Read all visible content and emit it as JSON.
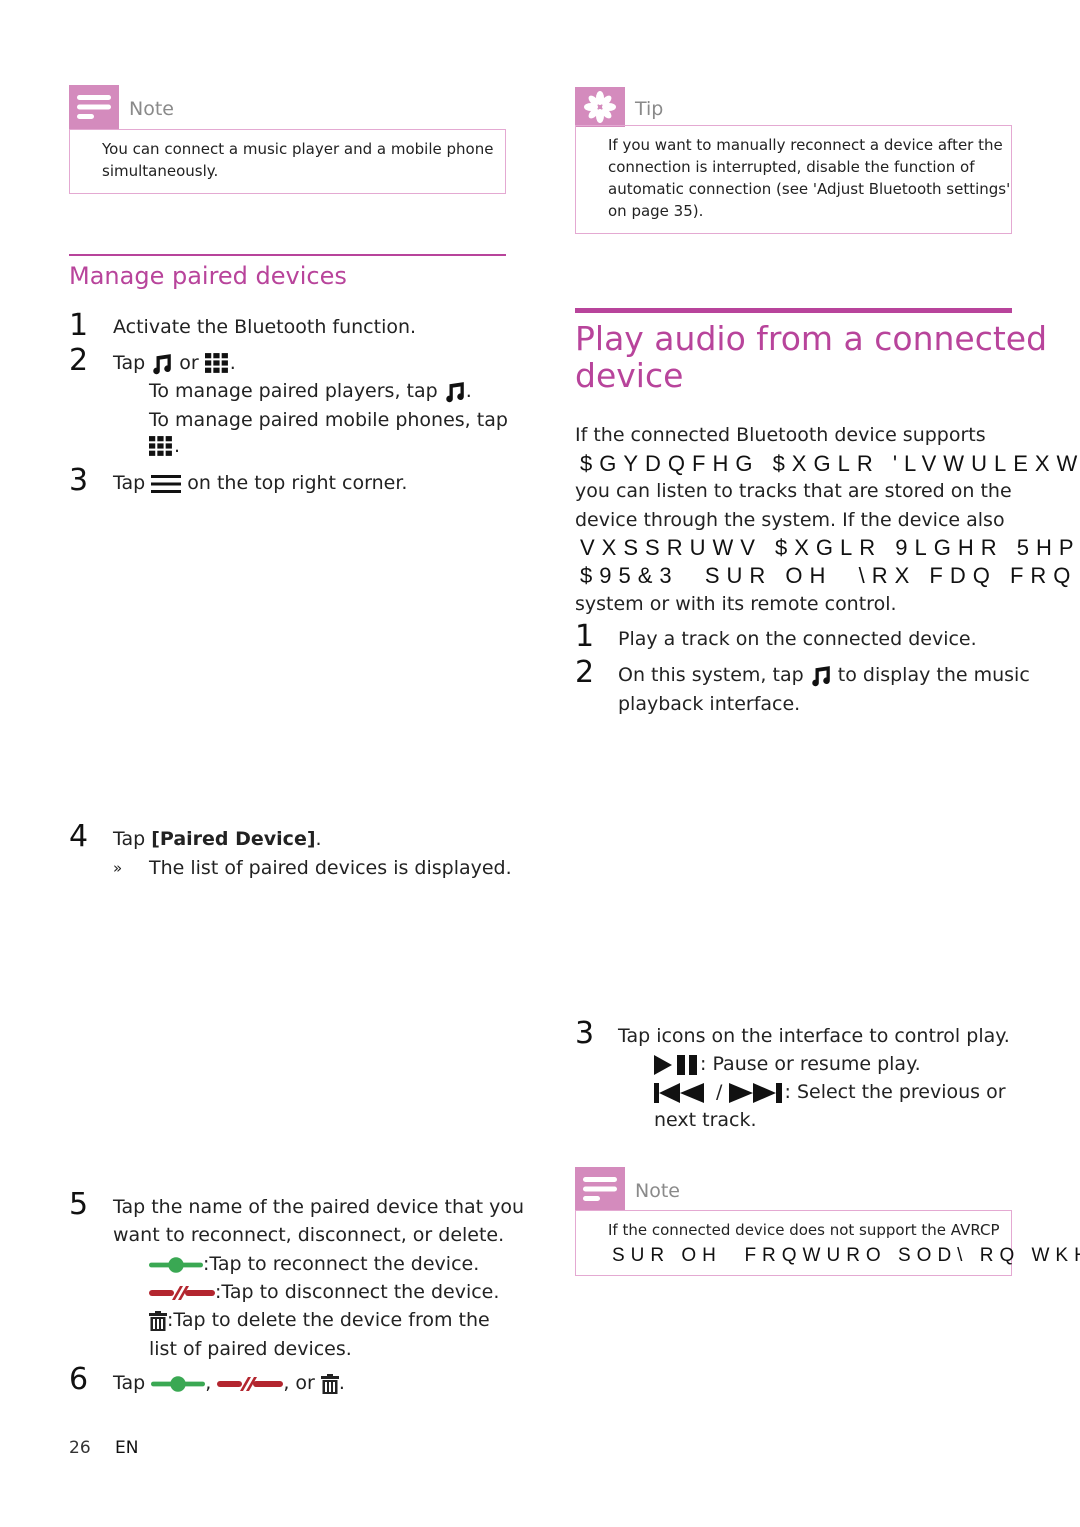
{
  "left": {
    "note": {
      "label": "Note",
      "icon": "note-lines-icon",
      "text_lines": [
        "You can connect a music player and a mobile phone",
        "simultaneously."
      ]
    },
    "section_title": "Manage paired devices",
    "steps": [
      {
        "num": "1",
        "text": "Activate the Bluetooth function."
      },
      {
        "num": "2",
        "text_a": "Tap",
        "text_b": "or",
        "text_c": ".",
        "sub1": "To manage paired players, tap",
        "sub1_end": ".",
        "sub2": "To manage paired mobile phones, tap",
        "sub2_end": "."
      },
      {
        "num": "3",
        "text_a": "Tap",
        "text_b": "on the top right corner."
      },
      {
        "num": "4",
        "text_a": "Tap",
        "bold": "[Paired Device]",
        "text_b": ".",
        "result_marker": "»",
        "result": "The list of paired devices is displayed."
      },
      {
        "num": "5",
        "line1": "Tap the name of the paired device that you",
        "line2": "want to reconnect, disconnect, or delete.",
        "reconnect": ":Tap to reconnect the device.",
        "disconnect": ":Tap to disconnect the device.",
        "delete_a": ":Tap to delete the device from the",
        "delete_b": "list of paired devices."
      },
      {
        "num": "6",
        "text_a": "Tap",
        "sep1": ",",
        "sep2": ", or",
        "end": "."
      }
    ]
  },
  "right": {
    "tip": {
      "label": "Tip",
      "icon": "asterisk-icon",
      "text_lines": [
        "If you want to manually reconnect a device after the",
        "connection is interrupted, disable the function of",
        "automatic connection (see 'Adjust Bluetooth settings'",
        "on page 35)."
      ]
    },
    "section_title_lines": [
      "Play audio from a connected",
      "device"
    ],
    "intro": {
      "line1": "If the connected Bluetooth device supports",
      "garbled1": "$GYDQFHG $XGLR 'LVWULEXW",
      "line3": "you can listen to tracks that are stored on the",
      "line4": "device through the system. If the device also",
      "garbled2": "VXSSRUWV $XGLR 9LGHR 5HP",
      "garbled3": "$95&3  SUR OH  \\RX FDQ FRQ",
      "line7": "system or with its remote control."
    },
    "steps": [
      {
        "num": "1",
        "text": "Play a track on the connected device."
      },
      {
        "num": "2",
        "text_a": "On this system, tap",
        "text_b": "to display the music",
        "line2": "playback interface."
      },
      {
        "num": "3",
        "text": "Tap icons on the interface to control play.",
        "play_pause": ": Pause or resume play.",
        "slash": "/",
        "prev_next_a": ": Select the previous or",
        "prev_next_b": "next track."
      }
    ],
    "note": {
      "label": "Note",
      "icon": "note-lines-icon",
      "line1": "If the connected device does not support the AVRCP",
      "garbled": "SUR OH  FRQWURO SOD\\ RQ WKH FF"
    }
  },
  "footer": {
    "page_number": "26",
    "language": "EN"
  },
  "colors": {
    "accent": "#b8449b",
    "callout": "#d48bbd",
    "callout_border": "#e4a9d2",
    "connect_green": "#3aa853",
    "disconnect_red": "#b3262f"
  }
}
